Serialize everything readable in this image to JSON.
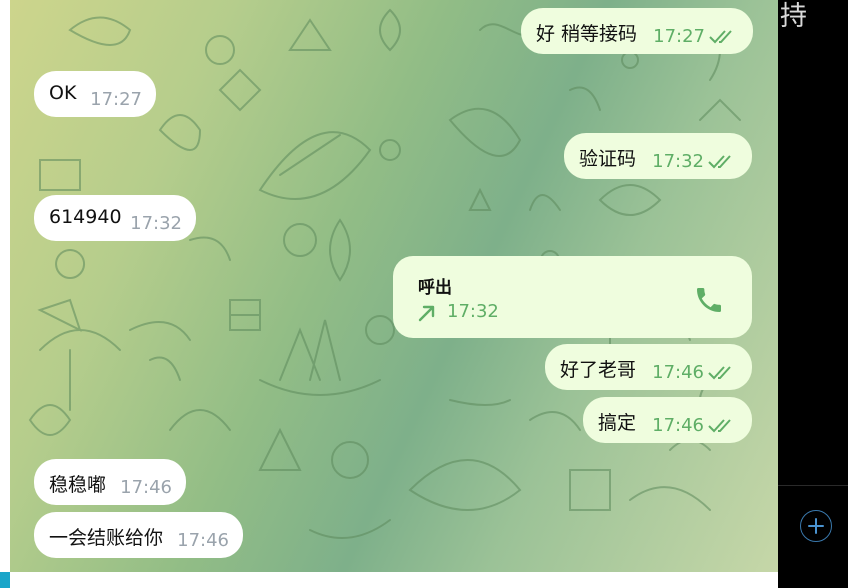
{
  "header": {
    "partial_title": "持"
  },
  "colors": {
    "incoming_bubble": "#ffffff",
    "outgoing_bubble": "#effdde",
    "read_tick": "#5fae66",
    "call_icon": "#5fae66",
    "accent": "#1aa5c9"
  },
  "messages": [
    {
      "side": "out",
      "text": "好 稍等接码",
      "time": "17:27",
      "status": "read"
    },
    {
      "side": "in",
      "text": "OK",
      "time": "17:27"
    },
    {
      "side": "out",
      "text": "验证码",
      "time": "17:32",
      "status": "read"
    },
    {
      "side": "in",
      "text": "614940",
      "time": "17:32"
    },
    {
      "side": "out",
      "text": "好了老哥",
      "time": "17:46",
      "status": "read"
    },
    {
      "side": "out",
      "text": "搞定",
      "time": "17:46",
      "status": "read"
    },
    {
      "side": "in",
      "text": "稳稳嘟",
      "time": "17:46"
    },
    {
      "side": "in",
      "text": "一会结账给你",
      "time": "17:46"
    }
  ],
  "call": {
    "title": "呼出",
    "time": "17:32",
    "direction_icon": "outgoing-arrow-icon",
    "action_icon": "phone-icon"
  },
  "sidebar": {
    "add_icon": "plus-icon"
  }
}
